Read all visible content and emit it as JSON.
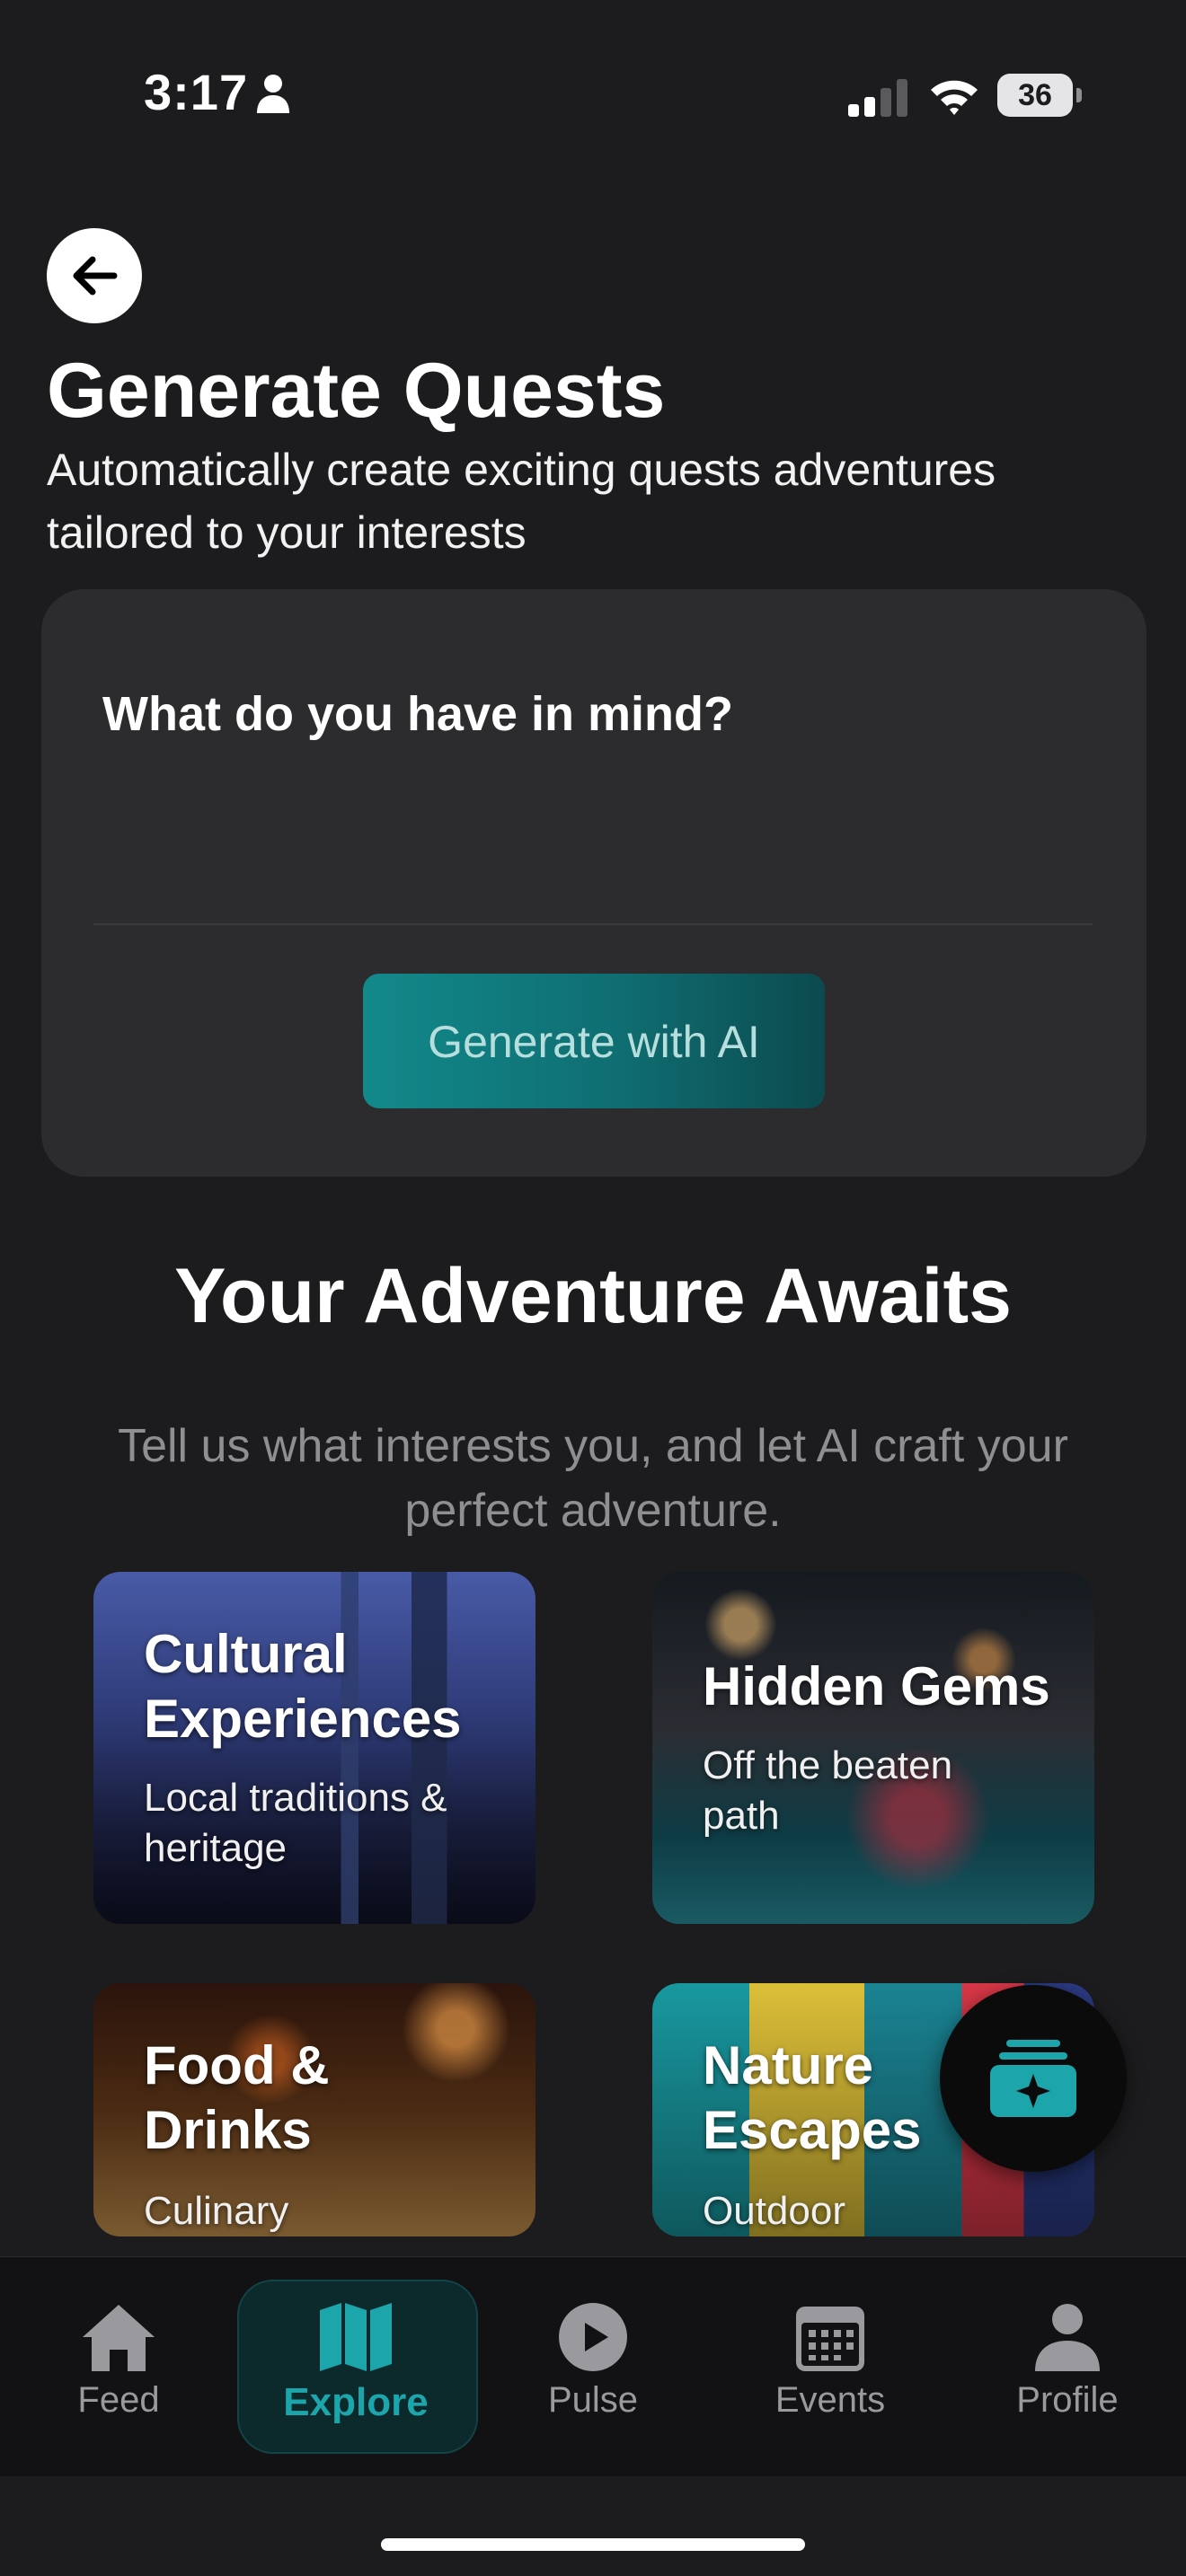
{
  "status_bar": {
    "time": "3:17",
    "battery": "36"
  },
  "header": {
    "title": "Generate Quests",
    "subtitle": "Automatically create exciting quests adventures tailored to your interests"
  },
  "prompt_card": {
    "label": "What do you have in mind?",
    "input_value": "",
    "button_label": "Generate with AI"
  },
  "section": {
    "heading": "Your Adventure Awaits",
    "description": "Tell us what interests you, and let AI craft your perfect adventure."
  },
  "categories": [
    {
      "title": "Cultural Experiences",
      "description": "Local traditions & heritage"
    },
    {
      "title": "Hidden Gems",
      "description": "Off the beaten path"
    },
    {
      "title": "Food & Drinks",
      "description": "Culinary"
    },
    {
      "title": "Nature Escapes",
      "description": "Outdoor"
    }
  ],
  "tabs": [
    {
      "label": "Feed",
      "icon": "home-icon"
    },
    {
      "label": "Explore",
      "icon": "map-icon",
      "active": true
    },
    {
      "label": "Pulse",
      "icon": "play-icon"
    },
    {
      "label": "Events",
      "icon": "calendar-icon"
    },
    {
      "label": "Profile",
      "icon": "person-icon"
    }
  ],
  "colors": {
    "accent": "#1ca6ac",
    "background": "#1c1c1e",
    "card": "#2c2c2e"
  }
}
